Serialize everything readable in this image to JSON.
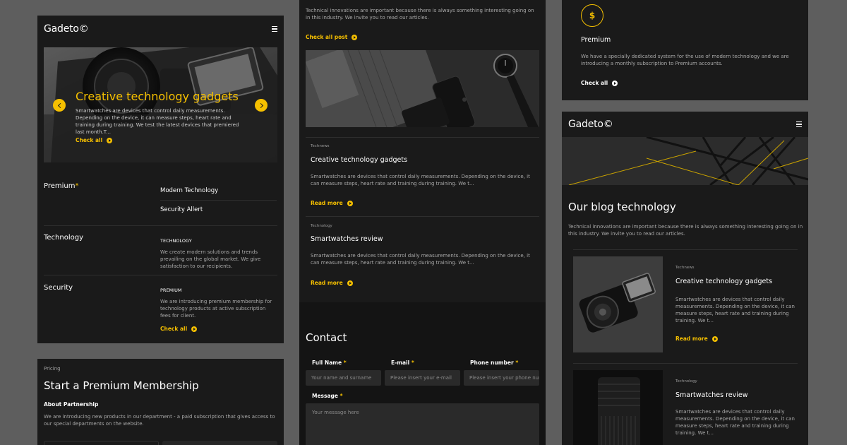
{
  "panel_left": {
    "logo": "Gadeto©",
    "hero": {
      "title": "Creative technology gadgets",
      "text": "Smartwatches are devices that control daily measurements. Depending on the device, it can measure steps, heart rate and training during training. We test the latest devices that premiered last month.T...",
      "link": "Check all"
    },
    "menu_left": [
      "Premium",
      "Technology",
      "Security"
    ],
    "premium_star": "*",
    "menu_right": [
      "Modern Technology",
      "Security Allert"
    ],
    "technology": {
      "heading": "TECHNOLOGY",
      "text": "We create modern solutions and trends prevailing on the global market. We give satisfaction to our recipients."
    },
    "premium": {
      "heading": "PREMIUM",
      "text": "We are introducing premium membership for technology products at active subscription fees for client.",
      "link": "Check all"
    }
  },
  "panel_pricing": {
    "eyebrow": "Pricing",
    "title": "Start a Premium Membership",
    "subtitle": "About Partnership",
    "text": "We are introducing new products in our department - a paid subscription that gives access to our special departments on the website."
  },
  "panel_middle": {
    "intro": "Technical innovations are important because there is always something interesting going on in this industry. We invite you to read our articles.",
    "check_all": "Check all post",
    "posts": [
      {
        "category": "Technews",
        "title": "Creative technology gadgets",
        "text": "Smartwatches are devices that control daily measurements. Depending on the device, it can measure steps, heart rate and training during training. We t...",
        "link": "Read more"
      },
      {
        "category": "Technology",
        "title": "Smartwatches review",
        "text": "Smartwatches are devices that control daily measurements. Depending on the device, it can measure steps, heart rate and training during training. We t...",
        "link": "Read more"
      }
    ],
    "contact": {
      "title": "Contact",
      "full_name_label": "Full Name",
      "full_name_placeholder": "Your name and surname",
      "email_label": "E-mail",
      "email_placeholder": "Please insert your e-mail",
      "phone_label": "Phone number",
      "phone_placeholder": "Please insert your phone number",
      "message_label": "Message",
      "message_placeholder": "Your message here",
      "required": "*"
    }
  },
  "panel_premium_card": {
    "icon_symbol": "$",
    "title": "Premium",
    "text": "We have a specially dedicated system for the use of modern technology and we are introducing a monthly subscription to Premium accounts.",
    "link": "Check all"
  },
  "panel_right": {
    "logo": "Gadeto©",
    "title": "Our blog technology",
    "intro": "Technical innovations are important because there is always something interesting going on in this industry. We invite you to read our articles.",
    "posts": [
      {
        "category": "Technews",
        "title": "Creative technology gadgets",
        "text": "Smartwatches are devices that control daily measurements. Depending on the device, it can measure steps, heart rate and training during training. We t...",
        "link": "Read more"
      },
      {
        "category": "Technology",
        "title": "Smartwatches review",
        "text": "Smartwatches are devices that control daily measurements. Depending on the device, it can measure steps, heart rate and training during training. We t..."
      }
    ]
  },
  "colors": {
    "accent": "#f6c000",
    "panel": "#1a1a1a",
    "page": "#5e5e5e"
  }
}
